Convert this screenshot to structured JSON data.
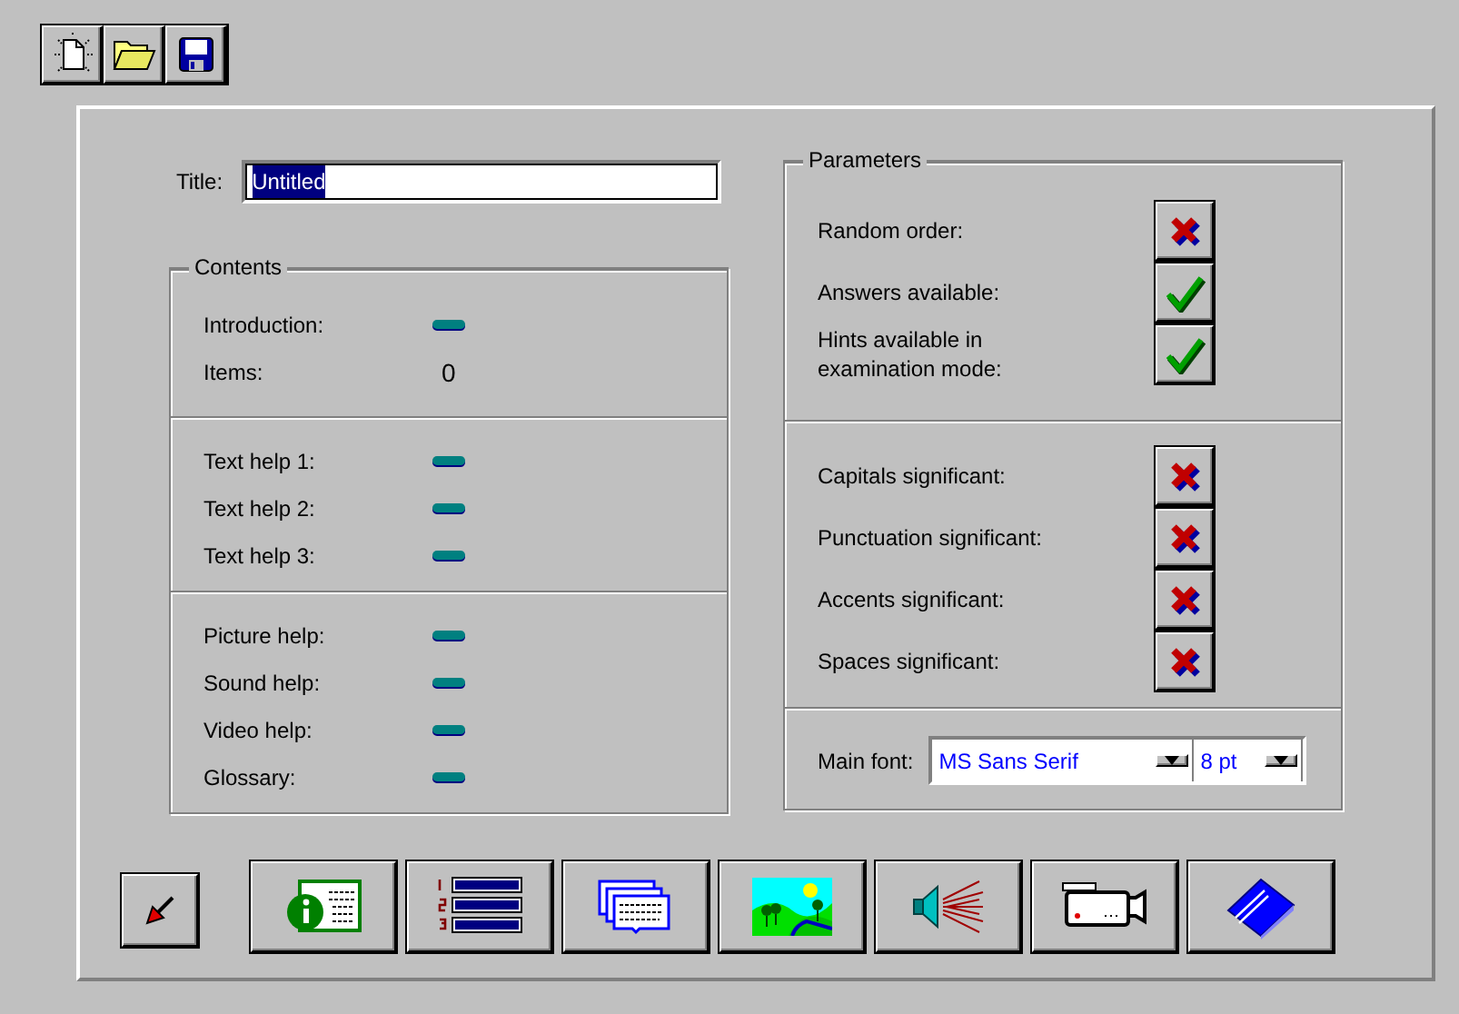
{
  "toolbar": [
    {
      "kind": "new"
    },
    {
      "kind": "open"
    },
    {
      "kind": "save"
    }
  ],
  "title": {
    "label": "Title:",
    "value": "Untitled",
    "text_selected": true
  },
  "contents": {
    "legend": "Contents",
    "sections": [
      {
        "rows": [
          {
            "label": "Introduction:",
            "kind": "indicator"
          },
          {
            "label": "Items:",
            "kind": "count",
            "value": "0"
          }
        ]
      },
      {
        "rows": [
          {
            "label": "Text help 1:",
            "kind": "indicator"
          },
          {
            "label": "Text help 2:",
            "kind": "indicator"
          },
          {
            "label": "Text help 3:",
            "kind": "indicator"
          }
        ]
      },
      {
        "rows": [
          {
            "label": "Picture help:",
            "kind": "indicator"
          },
          {
            "label": "Sound help:",
            "kind": "indicator"
          },
          {
            "label": "Video help:",
            "kind": "indicator"
          },
          {
            "label": "Glossary:",
            "kind": "indicator"
          }
        ]
      }
    ]
  },
  "parameters": {
    "legend": "Parameters",
    "sections": [
      {
        "rows": [
          {
            "label": "Random order:",
            "on": false
          },
          {
            "label": "Answers available:",
            "on": true
          },
          {
            "label": "Hints available in examination mode:",
            "on": true
          }
        ]
      },
      {
        "rows": [
          {
            "label": "Capitals significant:",
            "on": false
          },
          {
            "label": "Punctuation significant:",
            "on": false
          },
          {
            "label": "Accents significant:",
            "on": false
          },
          {
            "label": "Spaces significant:",
            "on": false
          }
        ]
      }
    ],
    "font": {
      "label": "Main font:",
      "family": "MS Sans Serif",
      "size": "8 pt"
    }
  },
  "bottom_buttons": [
    {
      "kind": "pointer"
    },
    {
      "kind": "info"
    },
    {
      "kind": "list"
    },
    {
      "kind": "cards"
    },
    {
      "kind": "picture"
    },
    {
      "kind": "sound"
    },
    {
      "kind": "video"
    },
    {
      "kind": "glossary"
    }
  ]
}
